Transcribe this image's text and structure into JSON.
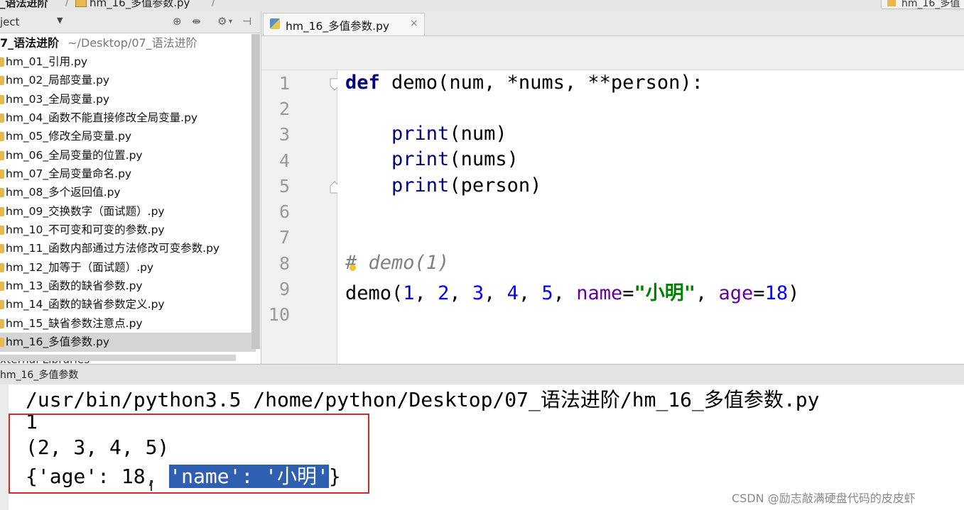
{
  "breadcrumb": {
    "folder": "_语法进阶",
    "file": "hm_16_多值参数.py",
    "right_tab": "hm_16_多值"
  },
  "project": {
    "header_label": "ject",
    "root_name": "7_语法进阶",
    "root_path": "~/Desktop/07_语法进阶",
    "files": [
      "hm_01_引用.py",
      "hm_02_局部变量.py",
      "hm_03_全局变量.py",
      "hm_04_函数不能直接修改全局变量.py",
      "hm_05_修改全局变量.py",
      "hm_06_全局变量的位置.py",
      "hm_07_全局变量命名.py",
      "hm_08_多个返回值.py",
      "hm_09_交换数字（面试题）.py",
      "hm_10_不可变和可变的参数.py",
      "hm_11_函数内部通过方法修改可变参数.py",
      "hm_12_加等于（面试题）.py",
      "hm_13_函数的缺省参数.py",
      "hm_14_函数的缺省参数定义.py",
      "hm_15_缺省参数注意点.py",
      "hm_16_多值参数.py"
    ],
    "selected_file": "hm_16_多值参数.py",
    "external_libraries": "xternal Libraries"
  },
  "editor": {
    "tab_label": "hm_16_多值参数.py",
    "tab_close": "×",
    "line_numbers": [
      "1",
      "2",
      "3",
      "4",
      "5",
      "6",
      "7",
      "8",
      "9",
      "10"
    ],
    "code": {
      "l1_def": "def",
      "l1_rest": " demo(num, *nums, **person):",
      "print_kw": "print",
      "l3_args": "(num)",
      "l4_args": "(nums)",
      "l5_args": "(person)",
      "l8_hash": "#",
      "l8_comment": " demo(1)",
      "l9_demo": "demo(",
      "l9_n1": "1",
      "l9_n2": "2",
      "l9_n3": "3",
      "l9_n4": "4",
      "l9_n5": "5",
      "l9_comma": ", ",
      "l9_name": "name",
      "l9_eq": "=",
      "l9_str": "\"小明\"",
      "l9_age": "age",
      "l9_n18": "18",
      "l9_close": ")"
    },
    "current_line": 9
  },
  "run": {
    "title": "hm_16_多值参数",
    "command": "/usr/bin/python3.5 /home/python/Desktop/07_语法进阶/hm_16_多值参数.py",
    "out1": "1",
    "out2": "(2, 3, 4, 5)",
    "out3_pre": "{'age': 18,",
    "out3_sel": "'name': '小明'",
    "out3_post": "}"
  },
  "watermark": "CSDN @励志敲满硬盘代码的皮皮虾",
  "colors": {
    "keyword": "#000080",
    "number": "#0000ff",
    "string": "#008000",
    "kwarg": "#660099",
    "comment": "#808080",
    "selection": "#2f5fb0",
    "highlight_box": "#d02a2a"
  }
}
